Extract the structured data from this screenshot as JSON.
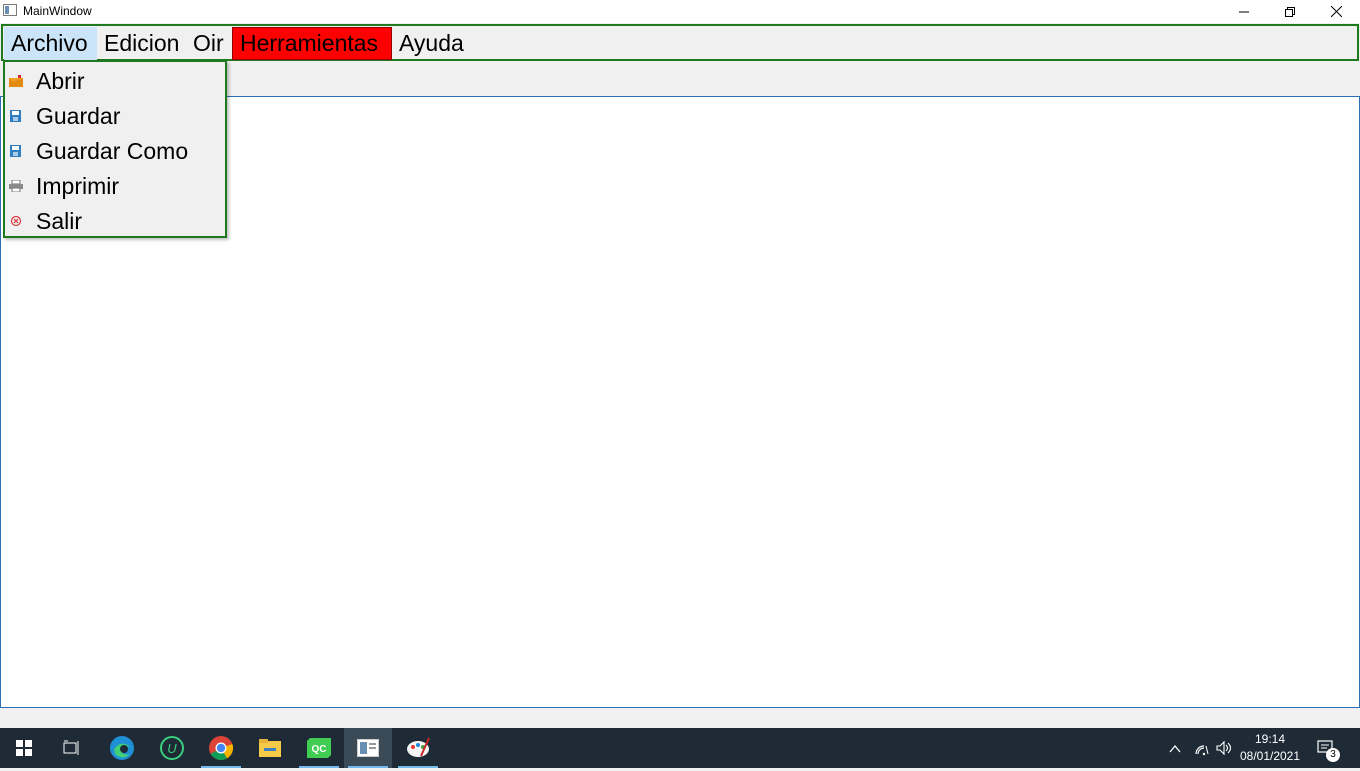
{
  "window": {
    "title": "MainWindow"
  },
  "menubar": {
    "items": [
      {
        "label": "Archivo"
      },
      {
        "label": "Edicion"
      },
      {
        "label": "Oir"
      },
      {
        "label": "Herramientas"
      },
      {
        "label": "Ayuda"
      }
    ]
  },
  "file_menu": {
    "items": [
      {
        "label": "Abrir",
        "icon": "open-folder-icon"
      },
      {
        "label": "Guardar",
        "icon": "save-icon"
      },
      {
        "label": "Guardar Como",
        "icon": "save-as-icon"
      },
      {
        "label": "Imprimir",
        "icon": "printer-icon"
      },
      {
        "label": "Salir",
        "icon": "exit-icon"
      }
    ]
  },
  "taskbar": {
    "clock": {
      "time": "19:14",
      "date": "08/01/2021"
    },
    "notification_count": "3",
    "apps": [
      "windows-start-icon",
      "task-view-icon",
      "edge-icon",
      "upwork-icon",
      "chrome-icon",
      "file-explorer-icon",
      "qt-creator-icon",
      "mainwindow-app-icon",
      "paint-icon"
    ]
  },
  "colors": {
    "menubar_border": "#1f7a1f",
    "highlight_red": "#ff0000",
    "active_menu": "#cce4f7",
    "taskbar": "#1e2b36"
  }
}
